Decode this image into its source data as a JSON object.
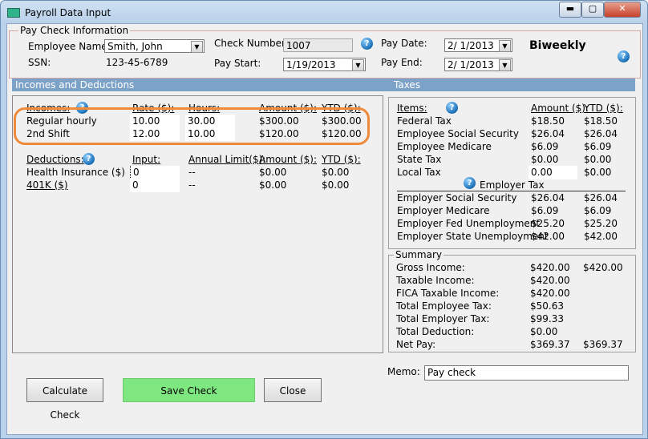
{
  "window": {
    "title": "Payroll Data Input",
    "minimize": "▬",
    "maximize": "▢",
    "close": "✕"
  },
  "pay_check_info": {
    "legend": "Pay Check Information",
    "employee_name_label": "Employee Name:",
    "employee_name_value": "Smith, John",
    "ssn_label": "SSN:",
    "ssn_value": "123-45-6789",
    "check_number_label": "Check Number:",
    "check_number_value": "1007",
    "pay_start_label": "Pay Start:",
    "pay_start_value": "1/19/2013",
    "pay_date_label": "Pay Date:",
    "pay_date_value": "2/  1/2013",
    "pay_end_label": "Pay End:",
    "pay_end_value": "2/  1/2013",
    "frequency": "Biweekly"
  },
  "incomes_deductions": {
    "header": "Incomes and Deductions",
    "incomes": {
      "headers": [
        "Incomes:",
        "Rate ($):",
        "Hours:",
        "Amount ($):",
        "YTD ($):"
      ],
      "rows": [
        {
          "name": "Regular hourly",
          "rate": "10.00",
          "hours": "30.00",
          "amount": "$300.00",
          "ytd": "$300.00"
        },
        {
          "name": "2nd Shift",
          "rate": "12.00",
          "hours": "10.00",
          "amount": "$120.00",
          "ytd": "$120.00"
        }
      ]
    },
    "deductions": {
      "headers": [
        "Deductions:",
        "Input:",
        "Annual Limit($):",
        "Amount ($):",
        "YTD ($):"
      ],
      "rows": [
        {
          "name": "Health Insurance  ($)",
          "input": "0",
          "limit": "--",
          "amount": "$0.00",
          "ytd": "$0.00"
        },
        {
          "name": "401K  ($)",
          "input": "0",
          "limit": "--",
          "amount": "$0.00",
          "ytd": "$0.00"
        }
      ]
    }
  },
  "taxes": {
    "header": "Taxes",
    "headers": [
      "Items:",
      "Amount ($):",
      "YTD ($):"
    ],
    "employee_rows": [
      {
        "name": "Federal Tax",
        "amount": "$18.50",
        "ytd": "$18.50"
      },
      {
        "name": "Employee Social Security",
        "amount": "$26.04",
        "ytd": "$26.04"
      },
      {
        "name": "Employee Medicare",
        "amount": "$6.09",
        "ytd": "$6.09"
      },
      {
        "name": "State Tax",
        "amount": "$0.00",
        "ytd": "$0.00"
      },
      {
        "name": "Local Tax",
        "amount": "0.00",
        "ytd": "$0.00"
      }
    ],
    "employer_label": "Employer Tax",
    "employer_rows": [
      {
        "name": "Employer Social Security",
        "amount": "$26.04",
        "ytd": "$26.04"
      },
      {
        "name": "Employer Medicare",
        "amount": "$6.09",
        "ytd": "$6.09"
      },
      {
        "name": "Employer Fed Unemployment",
        "amount": "$25.20",
        "ytd": "$25.20"
      },
      {
        "name": "Employer State Unemployment",
        "amount": "$42.00",
        "ytd": "$42.00"
      }
    ]
  },
  "summary": {
    "legend": "Summary",
    "rows": [
      {
        "label": "Gross Income:",
        "current": "$420.00",
        "ytd": "$420.00"
      },
      {
        "label": "Taxable Income:",
        "current": "$420.00",
        "ytd": ""
      },
      {
        "label": "FICA Taxable Income:",
        "current": "$420.00",
        "ytd": ""
      },
      {
        "label": "Total Employee Tax:",
        "current": "$50.63",
        "ytd": ""
      },
      {
        "label": "Total Employer Tax:",
        "current": "$99.33",
        "ytd": ""
      },
      {
        "label": "Total Deduction:",
        "current": "$0.00",
        "ytd": ""
      },
      {
        "label": "Net Pay:",
        "current": "$369.37",
        "ytd": "$369.37"
      }
    ]
  },
  "memo": {
    "label": "Memo:",
    "value": "Pay check"
  },
  "buttons": {
    "calculate": "Calculate Check",
    "save": "Save Check",
    "close": "Close"
  },
  "icons": {
    "help": "?",
    "combo_arrow": "▼"
  },
  "colors": {
    "section_bar": "#7da2c8",
    "save_button": "#7fe77f",
    "highlight": "#ee8a3a"
  }
}
